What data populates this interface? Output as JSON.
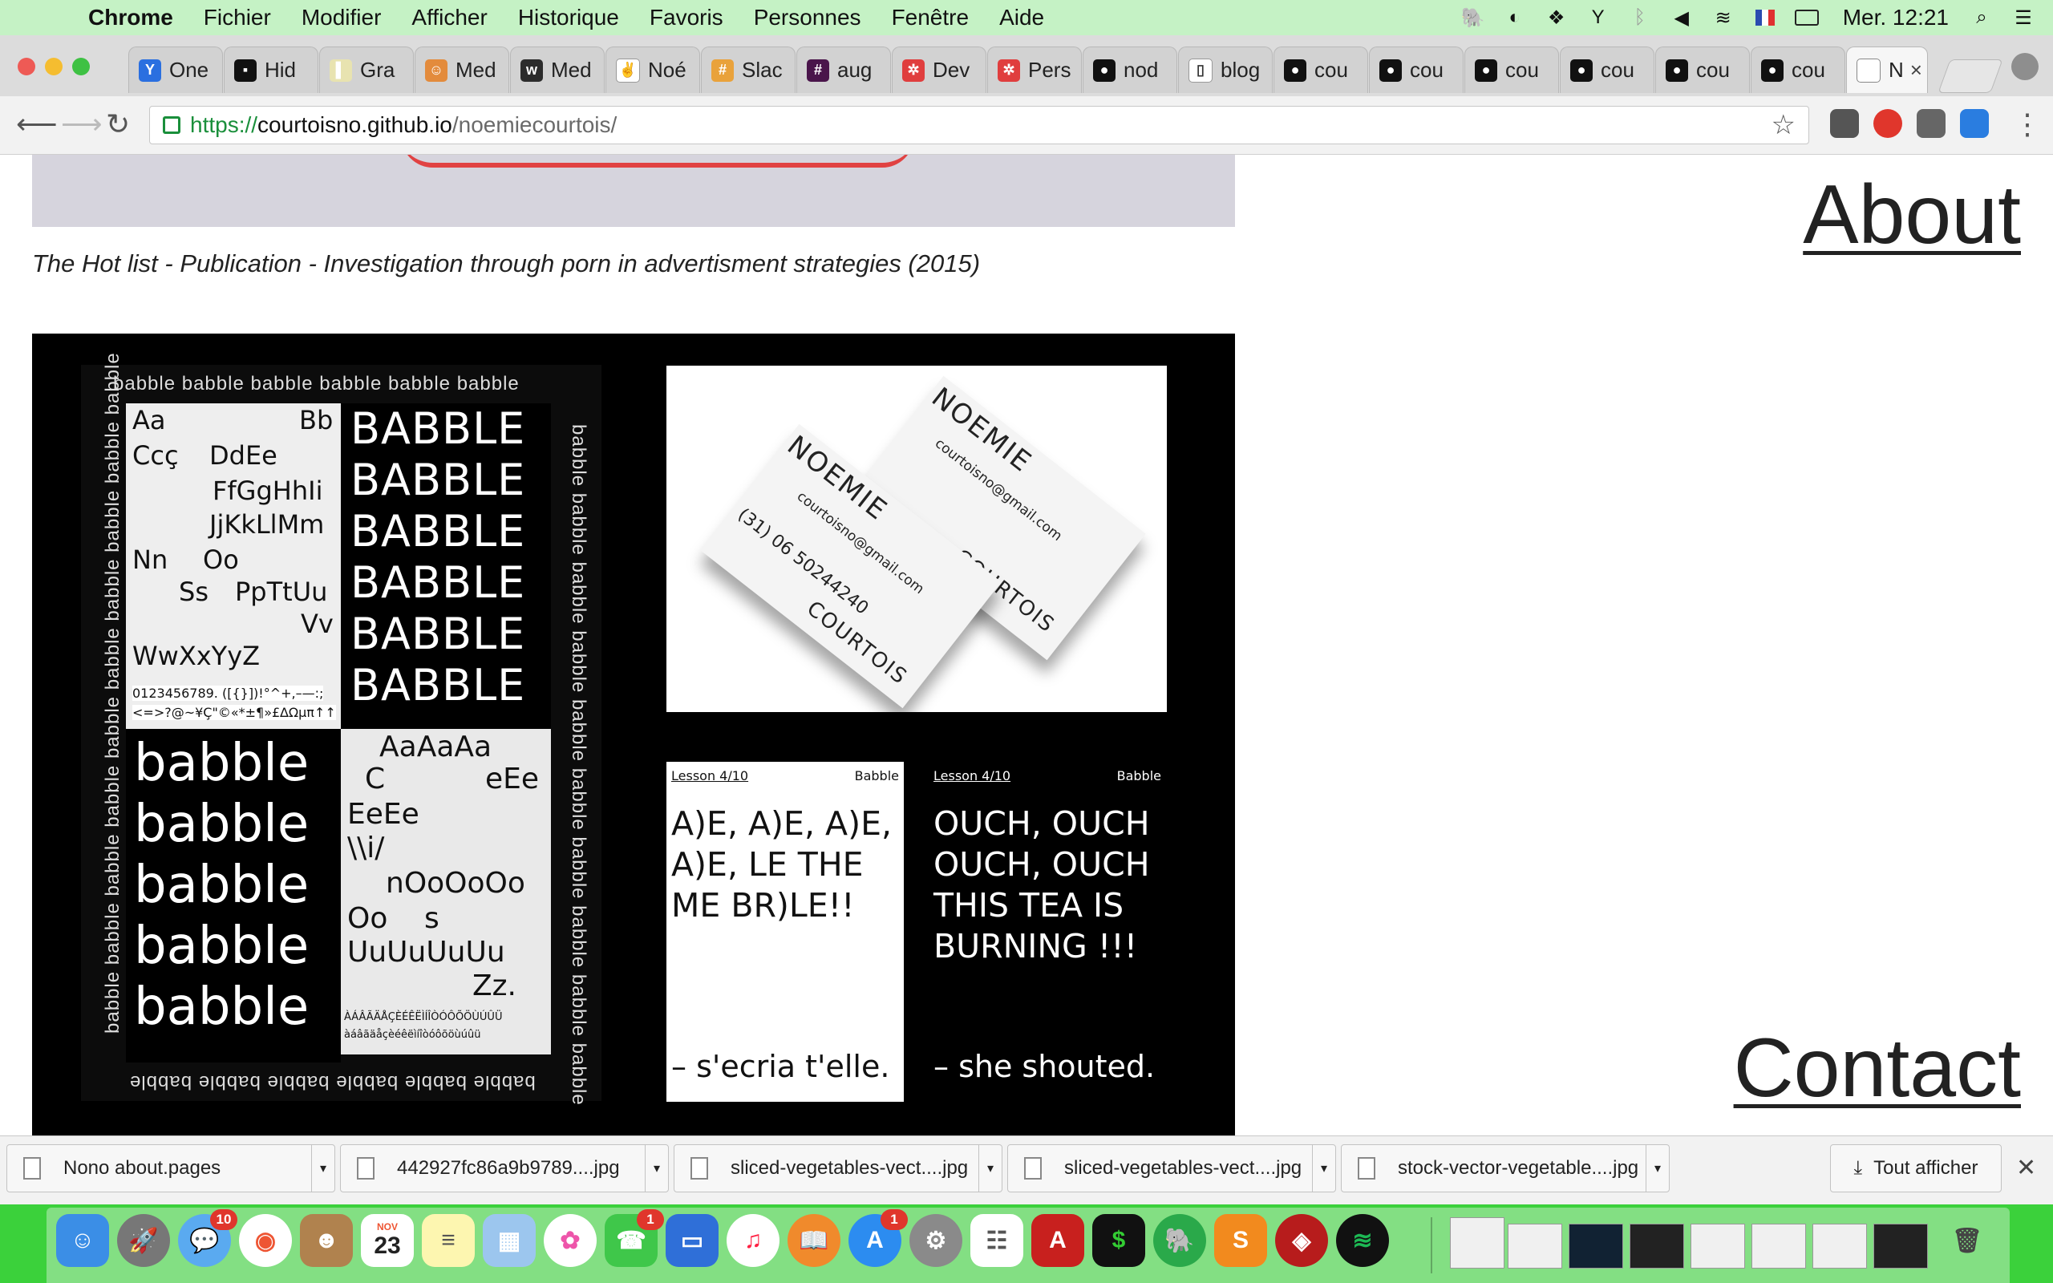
{
  "menubar": {
    "app_name": "Chrome",
    "items": [
      "Fichier",
      "Modifier",
      "Afficher",
      "Historique",
      "Favoris",
      "Personnes",
      "Fenêtre",
      "Aide"
    ],
    "clock": "Mer. 12:21"
  },
  "tabs": [
    {
      "label": "One",
      "favicon": "Y",
      "color": "#2a6fe0"
    },
    {
      "label": "Hid",
      "favicon": "▪",
      "color": "#111111"
    },
    {
      "label": "Gra",
      "favicon": "▌",
      "color": "#e8e3b0"
    },
    {
      "label": "Med",
      "favicon": "☺",
      "color": "#e38b3c"
    },
    {
      "label": "Med",
      "favicon": "w",
      "color": "#2c2c2c"
    },
    {
      "label": "Noé",
      "favicon": "✌",
      "color": "#ffffff"
    },
    {
      "label": "Slac",
      "favicon": "#",
      "color": "#e9a23b"
    },
    {
      "label": "aug",
      "favicon": "#",
      "color": "#4a154b"
    },
    {
      "label": "Dev",
      "favicon": "✲",
      "color": "#e03e3e"
    },
    {
      "label": "Pers",
      "favicon": "✲",
      "color": "#e03e3e"
    },
    {
      "label": "nod",
      "favicon": "●",
      "color": "#111111"
    },
    {
      "label": "blog",
      "favicon": "▯",
      "color": "#ffffff"
    },
    {
      "label": "cou",
      "favicon": "●",
      "color": "#111111"
    },
    {
      "label": "cou",
      "favicon": "●",
      "color": "#111111"
    },
    {
      "label": "cou",
      "favicon": "●",
      "color": "#111111"
    },
    {
      "label": "cou",
      "favicon": "●",
      "color": "#111111"
    },
    {
      "label": "cou",
      "favicon": "●",
      "color": "#111111"
    },
    {
      "label": "cou",
      "favicon": "●",
      "color": "#111111"
    }
  ],
  "active_tab": {
    "label": "N",
    "close": "×"
  },
  "address": {
    "scheme": "https://",
    "host": "courtoisno.github.io",
    "path": "/noemiecourtois/"
  },
  "page": {
    "caption": "The Hot list - Publication - Investigation through porn in advertisment strategies (2015)",
    "about": "About",
    "contact": "Contact"
  },
  "poster": {
    "strip": "babble babble babble babble babble babble",
    "strip_long": "babble babble babble babble babble babble babble babble babble babble",
    "specimen": [
      "Aa",
      "Bb",
      "Ccç",
      "DdEe",
      "FfGgHhIi",
      "JjKkLlMm",
      "Nn",
      "Oo",
      "Ss",
      "PpTtUu",
      "Vv",
      "WwXxYyZ"
    ],
    "digits": "0123456789. ([{}])!°^+,–—:;",
    "symbols": "<=>?@~¥Ç\"©«*±¶»£∆Ωµπ↑↑",
    "caps": [
      "BABBLE",
      "BABBLE",
      "BABBLE",
      "BABBLE",
      "BABBLE",
      "BABBLE"
    ],
    "lower": [
      "babble",
      "babble",
      "babble",
      "babble",
      "babble"
    ],
    "alts": [
      "AaAaAa",
      "C",
      "eEe",
      "EeEe",
      "\\\\i/",
      "nOoOoOo",
      "Oo",
      "s",
      "UuUuUuUu",
      "Zz.",
      "ÀÁÂÃÄÅÇÈÉÊËÌÍÎÒÓÔÕÖÙÚÛÜ",
      "àáâãäåçèéêëìíîòóôõöùúûü"
    ]
  },
  "cards": {
    "name_first": "NOEMIE",
    "name_last": "COURTOIS",
    "email": "courtoisno@gmail.com",
    "phone": "(31) 06 50244240"
  },
  "lessons": [
    {
      "num": "Lesson 4/10",
      "name": "Babble",
      "body": "A)E, A)E, A)E,\nA)E, LE THE\nME BR)LE!!",
      "foot": "– s'ecria t'elle."
    },
    {
      "num": "Lesson 4/10",
      "name": "Babble",
      "body": "OUCH, OUCH\nOUCH, OUCH\nTHIS TEA IS\nBURNING !!!",
      "foot": "– she shouted."
    }
  ],
  "downloads": {
    "items": [
      "Nono about.pages",
      "442927fc86a9b9789....jpg",
      "sliced-vegetables-vect....jpg",
      "sliced-vegetables-vect....jpg",
      "stock-vector-vegetable....jpg"
    ],
    "show_all": "Tout afficher"
  },
  "dock": {
    "mail_badge": "10",
    "facetime_badge": "1",
    "appstore_badge": "1",
    "calendar_month": "NOV",
    "calendar_day": "23"
  },
  "colors": {
    "menubar": "#c5f2c5",
    "dock": "#3bd13b",
    "secure": "#1a8f3b"
  }
}
